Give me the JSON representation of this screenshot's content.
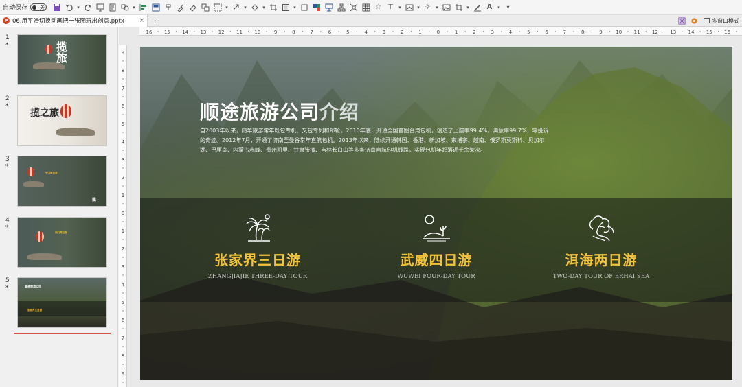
{
  "toolbar": {
    "autosave_label": "自动保存",
    "autosave_state": "关",
    "icons": [
      "save-icon",
      "undo-icon",
      "redo-icon",
      "presenter-icon",
      "new-slide-icon",
      "layout-icon",
      "shapes-icon",
      "align-icon",
      "format-painter-icon",
      "crop-icon",
      "chart-icon",
      "picture-icon",
      "arrange-icon",
      "text-box-icon",
      "fill-icon",
      "outline-icon",
      "effects-icon",
      "table-icon",
      "font-color-icon",
      "more-icon"
    ]
  },
  "tabbar": {
    "doc_tab": "06.用平滑切换动画把一张图玩出创意.pptx",
    "ppt_badge": "P",
    "close": "×",
    "add": "+",
    "multiwindow": "多窗口模式"
  },
  "thumbnails": [
    {
      "num": "1",
      "mark": "*",
      "title": "揽\n旅"
    },
    {
      "num": "2",
      "mark": "*",
      "title": "揽之旅"
    },
    {
      "num": "3",
      "mark": "*",
      "title": "",
      "gold": "天门两日游"
    },
    {
      "num": "4",
      "mark": "*",
      "title": "",
      "gold": "天门两日游"
    },
    {
      "num": "5",
      "mark": "*",
      "title": "",
      "gold": "张家界三日游"
    }
  ],
  "ruler": {
    "h_labels": [
      "16",
      "15",
      "14",
      "13",
      "12",
      "11",
      "10",
      "9",
      "8",
      "7",
      "6",
      "5",
      "4",
      "3",
      "2",
      "1",
      "0",
      "1",
      "2",
      "3",
      "4",
      "5",
      "6",
      "7",
      "8",
      "9",
      "10",
      "11",
      "12",
      "13",
      "14",
      "15",
      "16"
    ],
    "v_labels": [
      "9",
      "8",
      "7",
      "6",
      "5",
      "4",
      "3",
      "2",
      "1",
      "0",
      "1",
      "2",
      "3",
      "4",
      "5",
      "6",
      "7",
      "8",
      "9"
    ]
  },
  "slide": {
    "title_main": "顺途旅游公司",
    "title_fade": "介绍",
    "body": "自2003年以来，随华旅游常年既包专机、又包专列和邮轮。2010年底，开通全国首图台湾包机，创造了上座率99.4%，满意率99.7%，零投诉的奇迹。2012年7月，开通了济南至曼谷常年直航包机。2013年以来，陆续开通韩国、香港、新加坡、柬埔寨、越南、俄罗斯莫斯科、贝加尔湖、巴厘岛、内蒙古赤峰、贵州凯里、甘肃张掖、吉林长白山等多条济南直航包机线路，实现包机年起落近千余架次。",
    "tours": [
      {
        "icon": "palm-tree-icon",
        "title": "张家界三日游",
        "subtitle": "ZHANGJIAJIE THREE-DAY TOUR"
      },
      {
        "icon": "desert-sun-icon",
        "title": "武威四日游",
        "subtitle": "WUWEI FOUR-DAY TOUR"
      },
      {
        "icon": "tree-landscape-icon",
        "title": "洱海两日游",
        "subtitle": "TWO-DAY TOUR OF ERHAI SEA"
      }
    ]
  },
  "colors": {
    "accent_gold": "#f2c23a",
    "slide_band": "#141816",
    "insertion_line": "#d9534f"
  }
}
